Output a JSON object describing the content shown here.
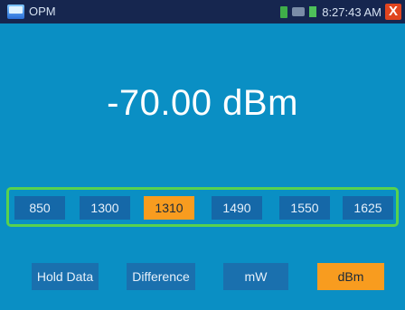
{
  "titlebar": {
    "title": "OPM",
    "time": "8:27:43 AM",
    "close_label": "X"
  },
  "reading": {
    "value": "-70.00 dBm"
  },
  "wavelengths": [
    {
      "label": "850",
      "active": false
    },
    {
      "label": "1300",
      "active": false
    },
    {
      "label": "1310",
      "active": true
    },
    {
      "label": "1490",
      "active": false
    },
    {
      "label": "1550",
      "active": false
    },
    {
      "label": "1625",
      "active": false
    }
  ],
  "controls": {
    "hold_data": "Hold Data",
    "difference": "Difference",
    "mw": "mW",
    "dbm": "dBm",
    "active_unit": "dBm"
  },
  "colors": {
    "background": "#0a8fc4",
    "titlebar": "#16264f",
    "button": "#1568a8",
    "accent": "#f89c1f",
    "frame": "#58d24e"
  }
}
